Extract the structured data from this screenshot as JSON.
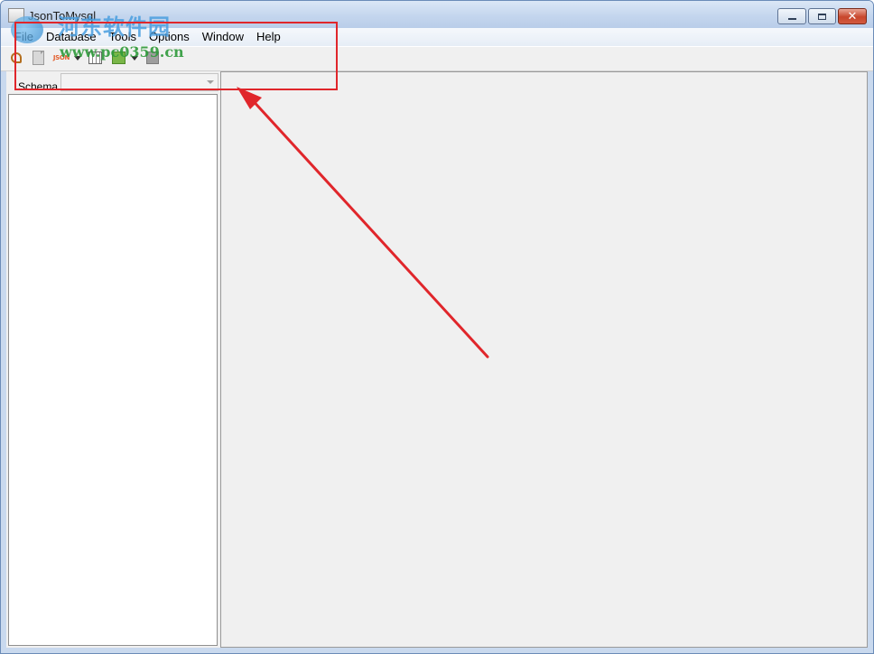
{
  "window": {
    "title": "JsonToMysql",
    "close_glyph": "✕"
  },
  "menubar": {
    "items": [
      "File",
      "Database",
      "Tools",
      "Options",
      "Window",
      "Help"
    ]
  },
  "toolbar": {
    "json_label": "JSON",
    "icons": [
      "wrench-icon",
      "page-icon",
      "json-icon",
      "dropdown-arrow-icon",
      "grid-icon",
      "green-export-icon",
      "dropdown-arrow-icon",
      "grey-icon"
    ]
  },
  "schema": {
    "label": "Schema",
    "selected": ""
  },
  "watermark": {
    "cn_text": "河东软件园",
    "url": "www.pc0359.cn"
  },
  "annotation": {
    "color": "#e0262b"
  }
}
